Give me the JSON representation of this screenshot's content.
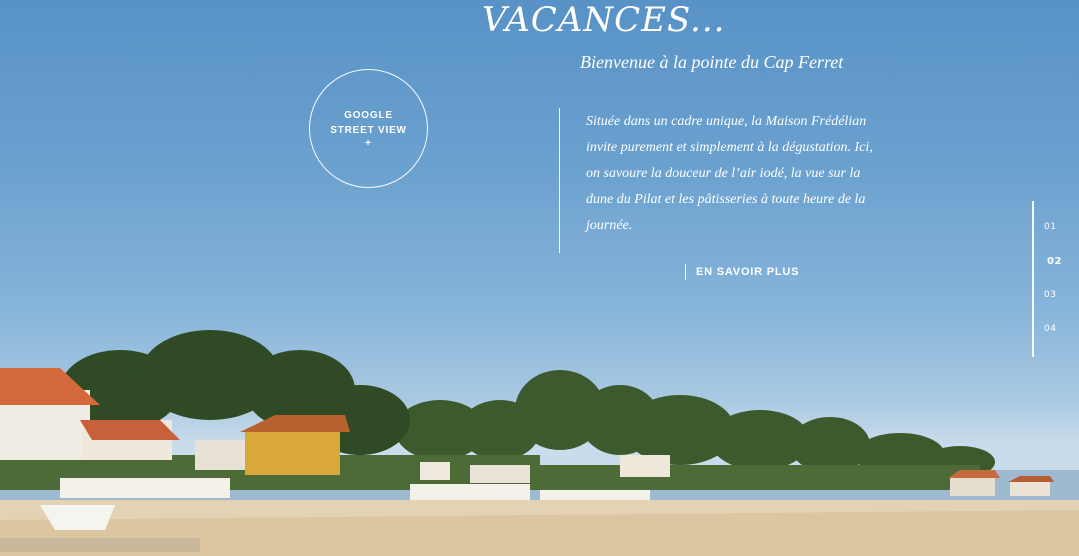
{
  "hero": {
    "title": "VACANCES...",
    "subtitle": "Bienvenue à la pointe du Cap Ferret"
  },
  "street_view": {
    "line1": "GOOGLE",
    "line2": "STREET VIEW",
    "plus": "+"
  },
  "intro": {
    "text": "Située dans un cadre unique, la Maison Frédélian invite purement et simplement à la dégustation. Ici, on savoure la douceur de l’air iodé, la vue sur la dune du Pilat et les pâtisseries à toute heure de la journée."
  },
  "cta": {
    "label": "EN SAVOIR PLUS"
  },
  "pager": {
    "items": [
      "01",
      "02",
      "03",
      "04"
    ],
    "active_index": 1
  },
  "colors": {
    "sky": "#5892c6",
    "text": "#ffffff",
    "sand": "#e2cfae"
  }
}
